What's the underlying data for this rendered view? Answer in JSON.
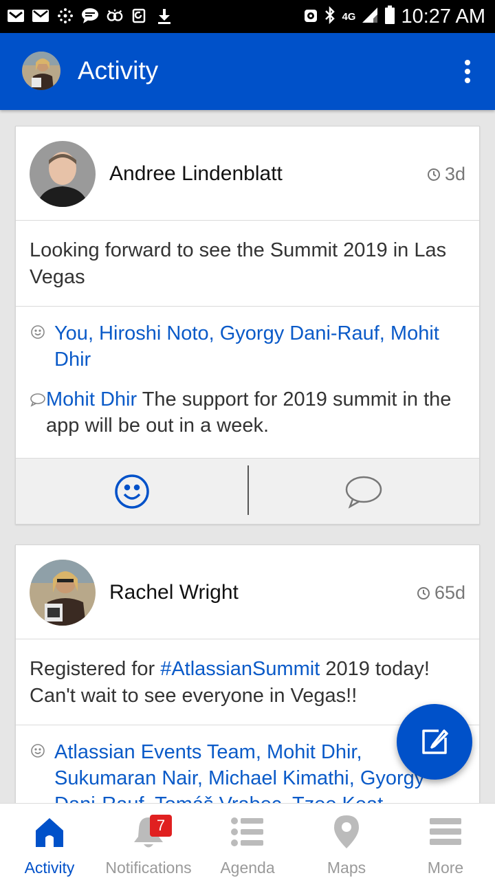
{
  "status_bar": {
    "time": "10:27 AM",
    "network": "4G"
  },
  "app_bar": {
    "title": "Activity"
  },
  "posts": [
    {
      "author": "Andree Lindenblatt",
      "age": "3d",
      "text": "Looking forward to see the Summit 2019 in Las Vegas",
      "likes": "You, Hiroshi Noto, Gyorgy Dani-Rauf, Mohit Dhir",
      "comment": {
        "author": "Mohit Dhir",
        "text": " The support for 2019 summit in the app will be out in a week."
      }
    },
    {
      "author": "Rachel Wright",
      "age": "65d",
      "text_before": "Registered for ",
      "hashtag": "#AtlassianSummit",
      "text_after": " 2019 today!  Can't wait to see everyone in Vegas!!",
      "likes": "Atlassian Events Team, Mohit Dhir, Sukumaran Nair, Michael Kimathi, Gyorgy Dani-Rauf, Tomáš Vrabec, Tzee Keat"
    }
  ],
  "bottom_nav": {
    "items": [
      {
        "label": "Activity",
        "icon": "home-icon",
        "active": true
      },
      {
        "label": "Notifications",
        "icon": "bell-icon",
        "badge": "7"
      },
      {
        "label": "Agenda",
        "icon": "list-icon"
      },
      {
        "label": "Maps",
        "icon": "map-pin-icon"
      },
      {
        "label": "More",
        "icon": "menu-icon"
      }
    ]
  },
  "colors": {
    "primary": "#0051c9",
    "link": "#0a5ac8",
    "badge": "#e02020"
  }
}
